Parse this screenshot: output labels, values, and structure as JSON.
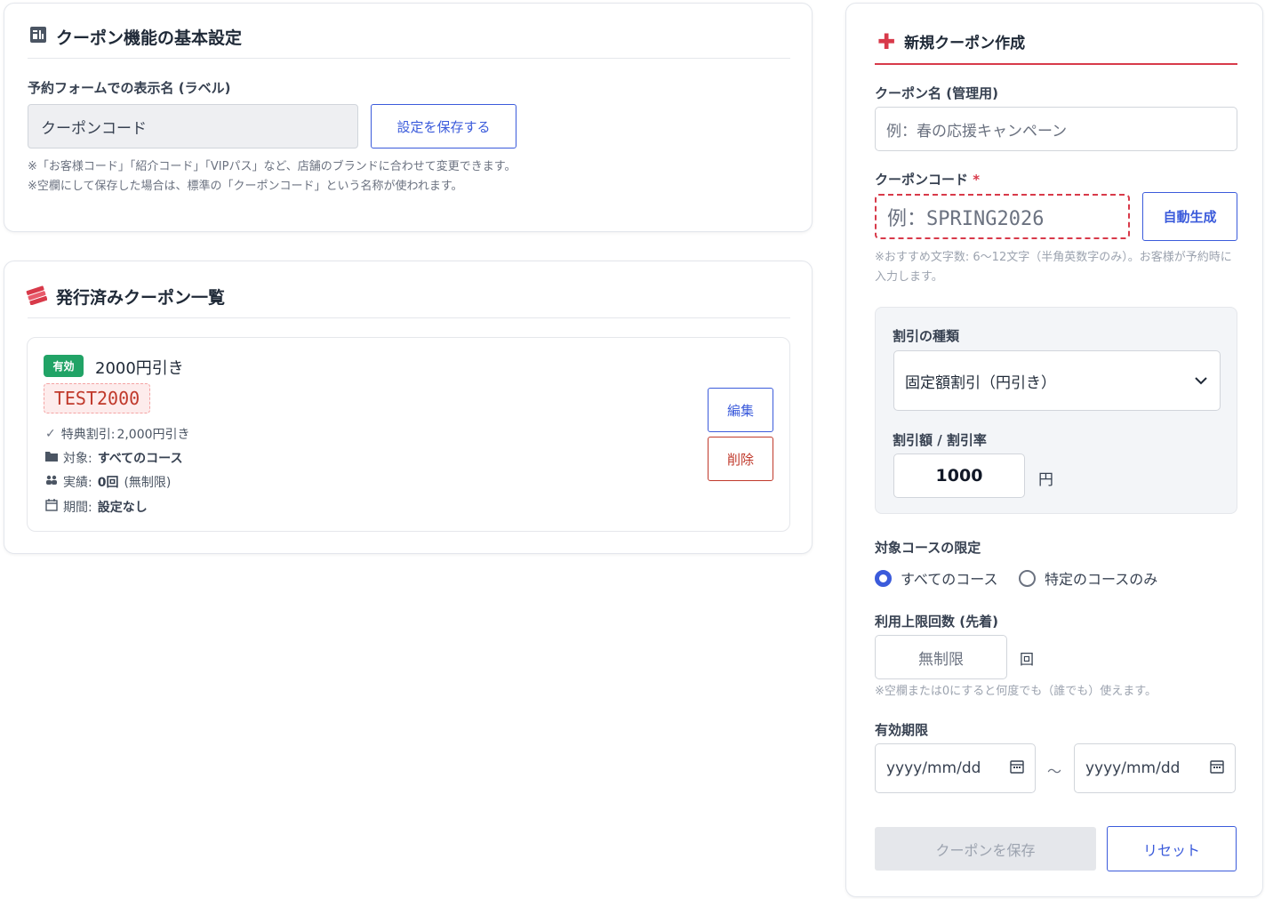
{
  "settings": {
    "title": "クーポン機能の基本設定",
    "label_field_label": "予約フォームでの表示名 (ラベル)",
    "label_value": "クーポンコード",
    "save_button": "設定を保存する",
    "note1": "※「お客様コード」「紹介コード」「VIPパス」など、店舗のブランドに合わせて変更できます。",
    "note2": "※空欄にして保存した場合は、標準の「クーポンコード」という名称が使われます。"
  },
  "list": {
    "title": "発行済みクーポン一覧",
    "coupons": [
      {
        "status": "有効",
        "name": "2000円引き",
        "code": "TEST2000",
        "benefit_label": "特典割引:",
        "benefit_value": "2,000円引き",
        "target_label": "対象:",
        "target_value": "すべてのコース",
        "usage_label": "実績:",
        "usage_value": "0回",
        "usage_extra": "(無制限)",
        "period_label": "期間:",
        "period_value": "設定なし",
        "edit_button": "編集",
        "delete_button": "削除"
      }
    ]
  },
  "create": {
    "title": "新規クーポン作成",
    "name_label": "クーポン名 (管理用)",
    "name_placeholder": "例：春の応援キャンペーン",
    "code_label": "クーポンコード",
    "required_mark": "*",
    "code_placeholder": "例：SPRING2026",
    "auto_button": "自動生成",
    "code_note": "※おすすめ文字数: 6〜12文字（半角英数字のみ）。お客様が予約時に入力します。",
    "discount_type_label": "割引の種類",
    "discount_type_value": "固定額割引（円引き）",
    "amount_label": "割引額 / 割引率",
    "amount_value": "1000",
    "amount_unit": "円",
    "course_label": "対象コースの限定",
    "course_options": [
      "すべてのコース",
      "特定のコースのみ"
    ],
    "course_selected": 0,
    "limit_label": "利用上限回数 (先着)",
    "limit_placeholder": "無制限",
    "limit_unit": "回",
    "limit_note": "※空欄または0にすると何度でも（誰でも）使えます。",
    "period_label": "有効期限",
    "date_placeholder_start": "yyyy/mm/dd",
    "date_separator": "〜",
    "date_placeholder_end": "yyyy/mm/dd",
    "save_button": "クーポンを保存",
    "reset_button": "リセット"
  },
  "colors": {
    "accent": "#3b5bdb",
    "danger": "#d83a4a",
    "success": "#21a366"
  }
}
